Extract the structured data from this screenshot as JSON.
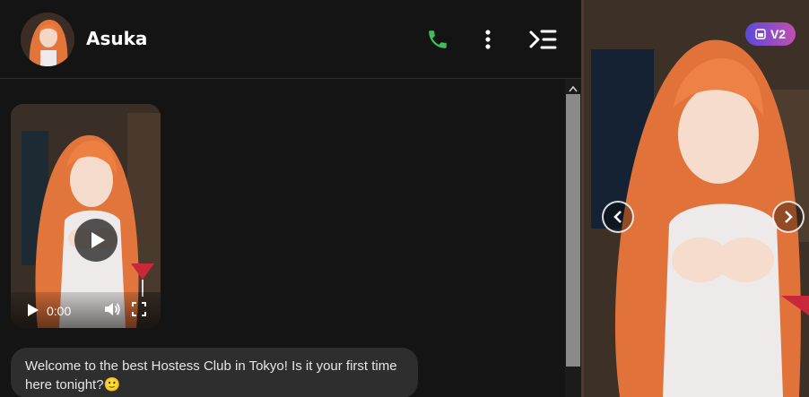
{
  "header": {
    "name": "Asuka",
    "avatar_icon": "avatar-portrait",
    "call_icon": "phone-icon",
    "menu_icon": "more-vertical-icon",
    "panel_icon": "collapse-panel-icon",
    "call_color": "#3fbf5a"
  },
  "messages": {
    "video": {
      "time": "0:00",
      "play_icon": "play-icon",
      "volume_icon": "volume-icon",
      "fullscreen_icon": "fullscreen-icon"
    },
    "greeting": "Welcome to the best Hostess Club in Tokyo! Is it your first time here tonight?🙂"
  },
  "side_panel": {
    "badge": "V2",
    "badge_icon": "image-icon",
    "prev_icon": "chevron-left-icon",
    "next_icon": "chevron-right-icon"
  }
}
